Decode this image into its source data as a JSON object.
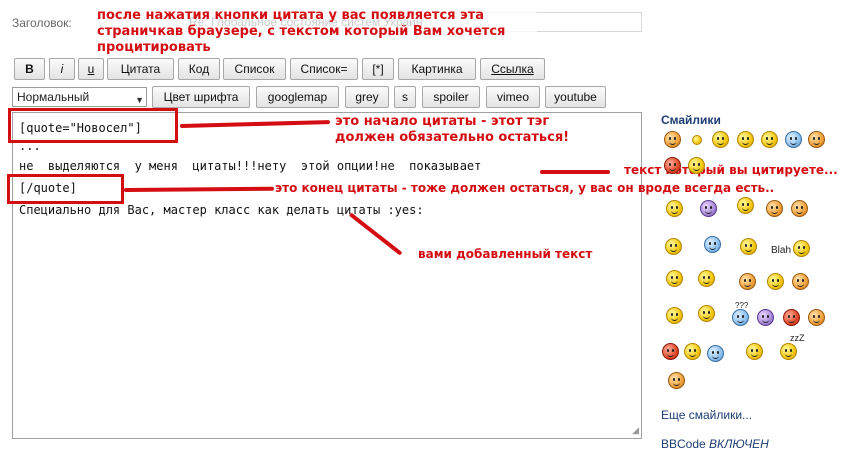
{
  "subject": {
    "label": "Заголовок:",
    "value": "Re: Глобальное состояние систем Украин"
  },
  "annotations": {
    "top": "после нажатия кнопки цитата у вас появляется эта страничкав браузере, с текстом который Вам хочется процитировать",
    "quote_start": "это начало цитаты - этот тэг должен обязательно остаться!",
    "quoted_text": "текст который вы цитируете...",
    "quote_end": "это конец цитаты - тоже должен остаться, у вас он вроде всегда есть..",
    "added_text": "вами добавленный текст"
  },
  "toolbar1": {
    "bold": "B",
    "italic": "i",
    "underline": "u",
    "quote": "Цитата",
    "code": "Код",
    "list": "Список",
    "list_eq": "Список=",
    "list_item": "[*]",
    "image": "Картинка",
    "link": "Ссылка"
  },
  "toolbar2": {
    "font_size_selected": "Нормальный",
    "font_color": "Цвет шрифта",
    "googlemap": "googlemap",
    "grey": "grey",
    "s": "s",
    "spoiler": "spoiler",
    "vimeo": "vimeo",
    "youtube": "youtube"
  },
  "editor": {
    "line1": "[quote=\"Новосел\"]",
    "line2": "...",
    "line3": "не  выделяются  у меня  цитаты!!!нету  этой опции!не  показывает",
    "line4": "[/quote]",
    "line5": "Специально для Вас, мастер класс как делать цитаты :yes:"
  },
  "smilies": {
    "title": "Смайлики",
    "blah_label": "Blah",
    "question_label": "???",
    "zzz_label": "zzZ",
    "more_link": "Еще смайлики...",
    "bbcode_prefix": "BBCode",
    "bbcode_state": "ВКЛЮЧЕН"
  },
  "colors": {
    "annotation_red": "#d40d12",
    "link_blue": "#1c3d72"
  }
}
